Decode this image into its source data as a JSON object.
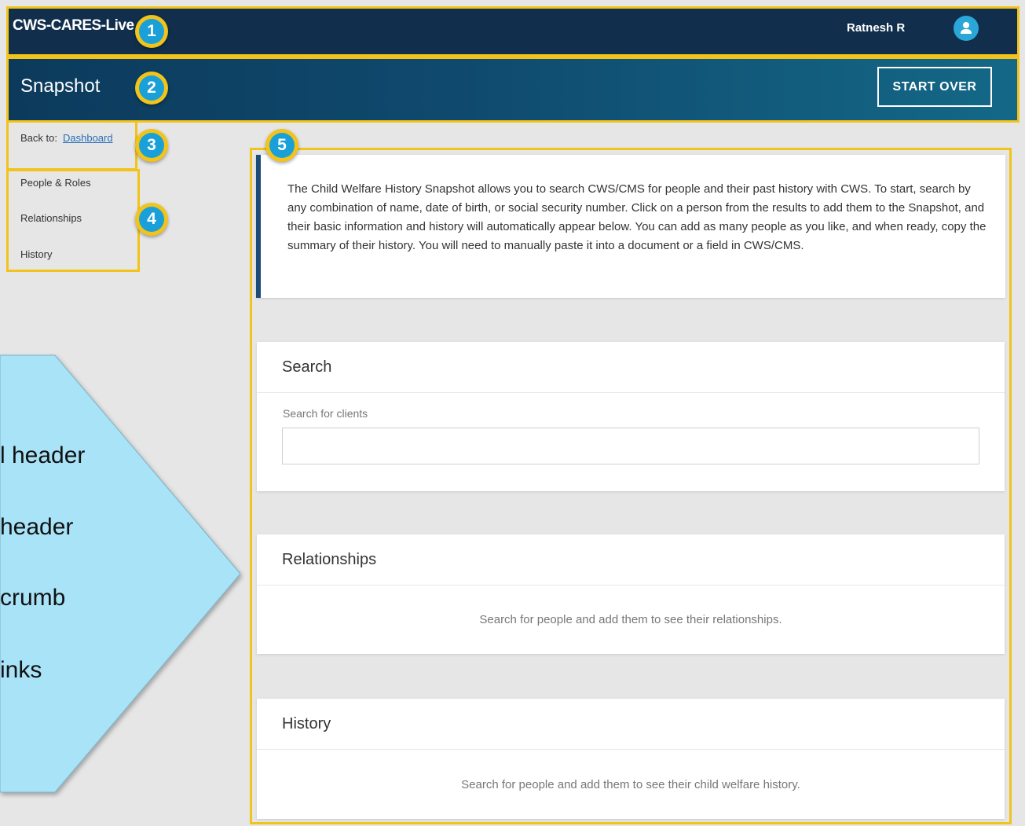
{
  "global_header": {
    "app_name": "CWS-CARES-Live",
    "user_name": "Ratnesh R",
    "user_icon": "user-icon"
  },
  "page_header": {
    "title": "Snapshot",
    "start_over_label": "START OVER"
  },
  "breadcrumb": {
    "prefix": "Back to:",
    "link_label": "Dashboard"
  },
  "side_nav": {
    "items": [
      {
        "label": "People & Roles"
      },
      {
        "label": "Relationships"
      },
      {
        "label": "History"
      }
    ]
  },
  "intro": {
    "text": "The Child Welfare History Snapshot allows you to search CWS/CMS for people and their past history with CWS. To start, search by any combination of name, date of birth, or social security number. Click on a person from the results to add them to the Snapshot, and their basic information and history will automatically appear below. You can add as many people as you like, and when ready, copy the summary of their history. You will need to manually paste it into a document or a field in CWS/CMS."
  },
  "search": {
    "title": "Search",
    "field_label": "Search for clients",
    "value": "",
    "placeholder": ""
  },
  "relationships": {
    "title": "Relationships",
    "empty_message": "Search for people and add them to see their relationships."
  },
  "history": {
    "title": "History",
    "empty_message": "Search for people and add them to see their child welfare history."
  },
  "callout": {
    "lines": [
      "l header",
      "header",
      "crumb",
      "inks"
    ]
  },
  "badges": [
    "1",
    "2",
    "3",
    "4",
    "5"
  ],
  "colors": {
    "highlight": "#f2c31a",
    "global_header_bg": "#112f4d",
    "badge_blue": "#1aa0d8",
    "callout_fill": "#a8e3f8",
    "link": "#2a6fb6"
  }
}
